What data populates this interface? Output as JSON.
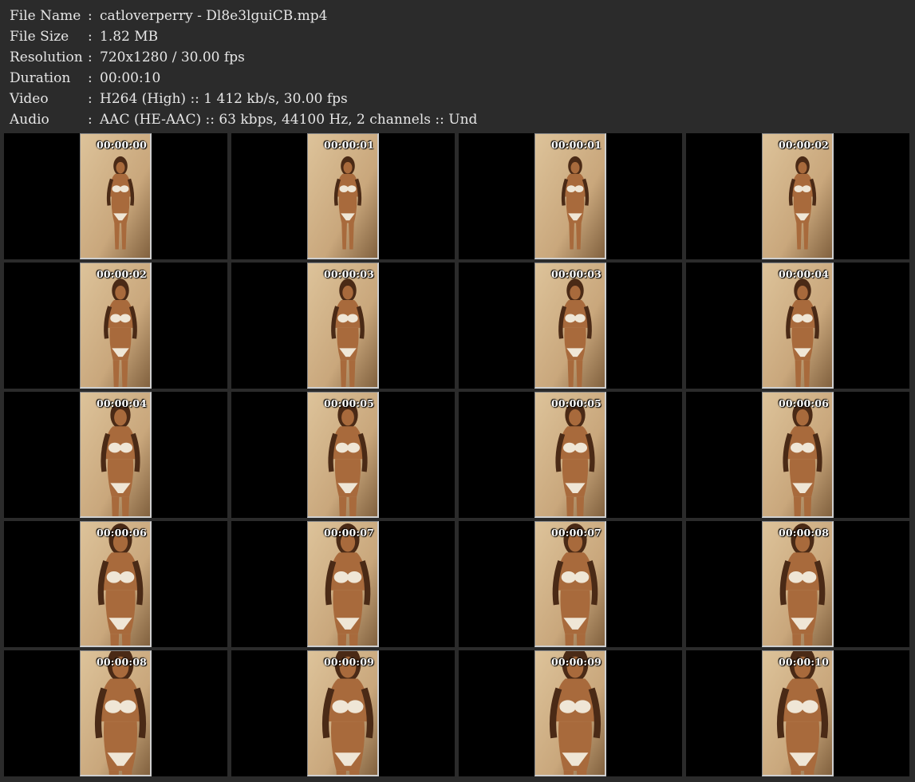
{
  "info": {
    "file_name_label": "File Name",
    "file_name": "catloverperry - Dl8e3lguiCB.mp4",
    "file_size_label": "File Size",
    "file_size": "1.82 MB",
    "resolution_label": "Resolution",
    "resolution": "720x1280 / 30.00 fps",
    "duration_label": "Duration",
    "duration": "00:00:10",
    "video_label": "Video",
    "video": "H264 (High) :: 1 412 kb/s, 30.00 fps",
    "audio_label": "Audio",
    "audio": "AAC (HE-AAC) :: 63 kbps, 44100 Hz, 2 channels :: Und",
    "separator": ":"
  },
  "thumbnails": [
    "00:00:00",
    "00:00:01",
    "00:00:01",
    "00:00:02",
    "00:00:02",
    "00:00:03",
    "00:00:03",
    "00:00:04",
    "00:00:04",
    "00:00:05",
    "00:00:05",
    "00:00:06",
    "00:00:06",
    "00:00:07",
    "00:00:07",
    "00:00:08",
    "00:00:08",
    "00:00:09",
    "00:00:09",
    "00:00:10"
  ],
  "colors": {
    "background": "#2b2b2b",
    "text": "#e6e6e6",
    "cell": "#000000",
    "wall": "#c9a77c",
    "skin": "#a86a3c",
    "hair": "#4a2a16",
    "bikini": "#efe6d6"
  }
}
